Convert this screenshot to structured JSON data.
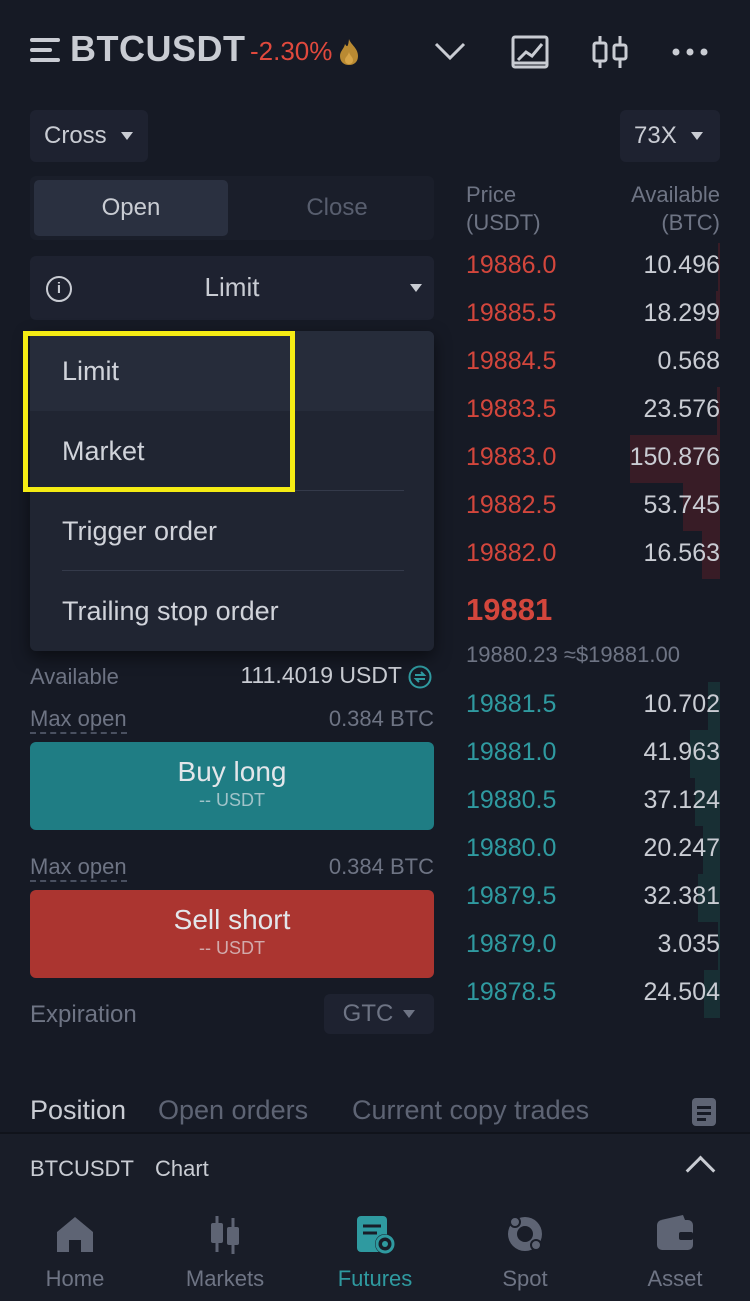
{
  "header": {
    "symbol": "BTCUSDT",
    "change": "-2.30%",
    "icons": [
      "menu-icon",
      "fire-icon",
      "chevron-down-icon",
      "chart-icon",
      "candlestick-icon",
      "more-icon"
    ]
  },
  "controls": {
    "margin_mode": "Cross",
    "leverage": "73X",
    "open_label": "Open",
    "close_label": "Close",
    "order_type": "Limit"
  },
  "dropdown": {
    "items": [
      "Limit",
      "Market",
      "Trigger order",
      "Trailing stop order"
    ],
    "selected": "Limit"
  },
  "form": {
    "available_label": "Available",
    "available_value": "111.4019 USDT",
    "max_open_label": "Max open",
    "max_open_buy": "0.384 BTC",
    "max_open_sell": "0.384 BTC",
    "buy_label": "Buy long",
    "buy_sub": "-- USDT",
    "sell_label": "Sell short",
    "sell_sub": "-- USDT",
    "expiration_label": "Expiration",
    "expiration_value": "GTC"
  },
  "orderbook": {
    "price_header_1": "Price",
    "price_header_2": "(USDT)",
    "amount_header_1": "Available",
    "amount_header_2": "(BTC)",
    "asks": [
      {
        "price": "19886.0",
        "amount": "10.496"
      },
      {
        "price": "19885.5",
        "amount": "18.299"
      },
      {
        "price": "19884.5",
        "amount": "0.568"
      },
      {
        "price": "19883.5",
        "amount": "23.576"
      },
      {
        "price": "19883.0",
        "amount": "150.876"
      },
      {
        "price": "19882.5",
        "amount": "53.745"
      },
      {
        "price": "19882.0",
        "amount": "16.563"
      }
    ],
    "last_price": "19881",
    "mark_price": "19880.23 ≈$19881.00",
    "bids": [
      {
        "price": "19881.5",
        "amount": "10.702"
      },
      {
        "price": "19881.0",
        "amount": "41.963"
      },
      {
        "price": "19880.5",
        "amount": "37.124"
      },
      {
        "price": "19880.0",
        "amount": "20.247"
      },
      {
        "price": "19879.5",
        "amount": "32.381"
      },
      {
        "price": "19879.0",
        "amount": "3.035"
      },
      {
        "price": "19878.5",
        "amount": "24.504"
      }
    ]
  },
  "tabs": {
    "items": [
      "Position",
      "Open orders",
      "Current copy trades"
    ],
    "active": "Position"
  },
  "mini_chart": {
    "symbol": "BTCUSDT",
    "label": "Chart"
  },
  "nav": {
    "items": [
      "Home",
      "Markets",
      "Futures",
      "Spot",
      "Asset"
    ],
    "active": "Futures"
  },
  "colors": {
    "ask": "#d3463c",
    "bid": "#2f9aa0",
    "buy_button": "#1f7d84",
    "sell_button": "#ab3530",
    "highlight": "#f5ec14"
  }
}
